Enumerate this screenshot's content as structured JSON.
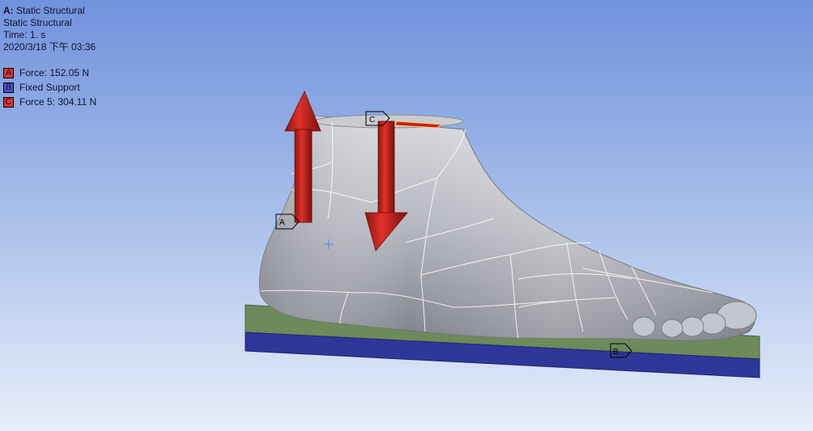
{
  "header": {
    "analysis_prefix": "A:",
    "analysis_title": "Static Structural",
    "analysis_type": "Static Structural",
    "time": "Time: 1. s",
    "timestamp": "2020/3/18 下午 03:36"
  },
  "legend": {
    "items": [
      {
        "letter": "A",
        "label": "Force: 152.05 N",
        "color": "#e2332c"
      },
      {
        "letter": "B",
        "label": "Fixed Support",
        "color": "#4b53c9"
      },
      {
        "letter": "C",
        "label": "Force 5: 304.11 N",
        "color": "#e2332c"
      }
    ]
  },
  "scene": {
    "model": "foot",
    "tags": {
      "a": "A",
      "b": "B",
      "c": "C"
    },
    "colors": {
      "background_top": "#6f92dc",
      "background_bottom": "#e8eefa",
      "force_arrow": "#c8201c",
      "support_top": "#6c8a5a",
      "support_side": "#2e3799",
      "model_surface": "#b9bcc3"
    }
  }
}
